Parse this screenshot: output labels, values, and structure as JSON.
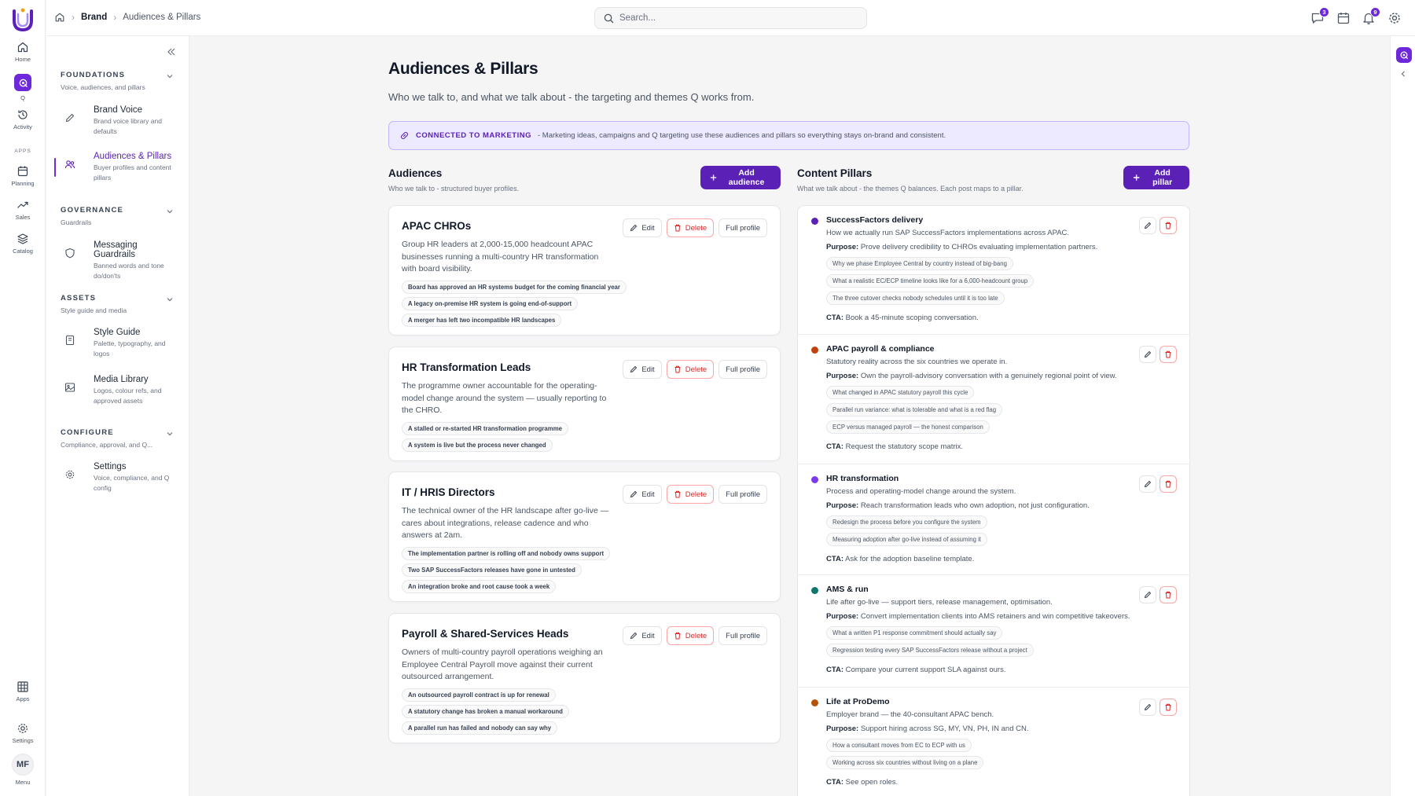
{
  "rail": {
    "items": [
      {
        "label": "Home",
        "icon": "home-icon"
      },
      {
        "label": "Q",
        "icon": "q-icon"
      },
      {
        "label": "Activity",
        "icon": "history-icon"
      },
      {
        "label": "Planning",
        "icon": "calendar-icon"
      },
      {
        "label": "Sales",
        "icon": "trend-icon"
      },
      {
        "label": "Catalog",
        "icon": "layers-icon"
      },
      {
        "label": "Apps",
        "icon": "grid-icon"
      },
      {
        "label": "Settings",
        "icon": "gear-icon"
      },
      {
        "label": "Menu",
        "icon": "avatar"
      }
    ],
    "apps_section": "APPS",
    "avatar_initials": "MF"
  },
  "topbar": {
    "breadcrumb": [
      "Brand",
      "Audiences & Pillars"
    ],
    "search_placeholder": "Search...",
    "messages_badge": "3",
    "notifications_badge": "9"
  },
  "sidebar": {
    "groups": [
      {
        "title": "FOUNDATIONS",
        "sub": "Voice, audiences, and pillars",
        "items": [
          {
            "title": "Brand Voice",
            "desc": "Brand voice library and defaults",
            "icon": "pen-icon"
          },
          {
            "title": "Audiences & Pillars",
            "desc": "Buyer profiles and content pillars",
            "icon": "users-icon"
          }
        ]
      },
      {
        "title": "GOVERNANCE",
        "sub": "Guardrails",
        "items": [
          {
            "title": "Messaging Guardrails",
            "desc": "Banned words and tone do/don'ts",
            "icon": "shield-icon"
          }
        ]
      },
      {
        "title": "ASSETS",
        "sub": "Style guide and media",
        "items": [
          {
            "title": "Style Guide",
            "desc": "Palette, typography, and logos",
            "icon": "book-icon"
          },
          {
            "title": "Media Library",
            "desc": "Logos, colour refs, and approved assets",
            "icon": "image-icon"
          }
        ]
      },
      {
        "title": "CONFIGURE",
        "sub": "Compliance, approval, and Q...",
        "items": [
          {
            "title": "Settings",
            "desc": "Voice, compliance, and Q config",
            "icon": "gear-icon"
          }
        ]
      }
    ]
  },
  "page": {
    "title": "Audiences & Pillars",
    "subtitle": "Who we talk to, and what we talk about - the targeting and themes Q works from.",
    "banner_label": "CONNECTED TO MARKETING",
    "banner_text": "- Marketing ideas, campaigns and Q targeting use these audiences and pillars so everything stays on-brand and consistent."
  },
  "audiences": {
    "title": "Audiences",
    "subtitle": "Who we talk to - structured buyer profiles.",
    "add_label": "Add audience",
    "edit_label": "Edit",
    "delete_label": "Delete",
    "profile_label": "Full profile",
    "items": [
      {
        "name": "APAC CHROs",
        "desc": "Group HR leaders at 2,000-15,000 headcount APAC businesses running a multi-country HR transformation with board visibility.",
        "triggers": [
          "Board has approved an HR systems budget for the coming financial year",
          "A legacy on-premise HR system is going end-of-support",
          "A merger has left two incompatible HR landscapes"
        ]
      },
      {
        "name": "HR Transformation Leads",
        "desc": "The programme owner accountable for the operating-model change around the system — usually reporting to the CHRO.",
        "triggers": [
          "A stalled or re-started HR transformation programme",
          "A system is live but the process never changed"
        ]
      },
      {
        "name": "IT / HRIS Directors",
        "desc": "The technical owner of the HR landscape after go-live — cares about integrations, release cadence and who answers at 2am.",
        "triggers": [
          "The implementation partner is rolling off and nobody owns support",
          "Two SAP SuccessFactors releases have gone in untested",
          "An integration broke and root cause took a week"
        ]
      },
      {
        "name": "Payroll & Shared-Services Heads",
        "desc": "Owners of multi-country payroll operations weighing an Employee Central Payroll move against their current outsourced arrangement.",
        "triggers": [
          "An outsourced payroll contract is up for renewal",
          "A statutory change has broken a manual workaround",
          "A parallel run has failed and nobody can say why"
        ]
      }
    ]
  },
  "pillars": {
    "title": "Content Pillars",
    "subtitle": "What we talk about - the themes Q balances. Each post maps to a pillar.",
    "add_label": "Add pillar",
    "purpose_label": "Purpose:",
    "cta_label": "CTA:",
    "items": [
      {
        "name": "SuccessFactors delivery",
        "color": "#5b21b6",
        "desc": "How we actually run SAP SuccessFactors implementations across APAC.",
        "purpose": "Prove delivery credibility to CHROs evaluating implementation partners.",
        "topics": [
          "Why we phase Employee Central by country instead of big-bang",
          "What a realistic EC/ECP timeline looks like for a 6,000-headcount group",
          "The three cutover checks nobody schedules until it is too late"
        ],
        "cta": "Book a 45-minute scoping conversation."
      },
      {
        "name": "APAC payroll & compliance",
        "color": "#c2410c",
        "desc": "Statutory reality across the six countries we operate in.",
        "purpose": "Own the payroll-advisory conversation with a genuinely regional point of view.",
        "topics": [
          "What changed in APAC statutory payroll this cycle",
          "Parallel run variance: what is tolerable and what is a red flag",
          "ECP versus managed payroll — the honest comparison"
        ],
        "cta": "Request the statutory scope matrix."
      },
      {
        "name": "HR transformation",
        "color": "#7c3aed",
        "desc": "Process and operating-model change around the system.",
        "purpose": "Reach transformation leads who own adoption, not just configuration.",
        "topics": [
          "Redesign the process before you configure the system",
          "Measuring adoption after go-live instead of assuming it"
        ],
        "cta": "Ask for the adoption baseline template."
      },
      {
        "name": "AMS & run",
        "color": "#0f766e",
        "desc": "Life after go-live — support tiers, release management, optimisation.",
        "purpose": "Convert implementation clients into AMS retainers and win competitive takeovers.",
        "topics": [
          "What a written P1 response commitment should actually say",
          "Regression testing every SAP SuccessFactors release without a project"
        ],
        "cta": "Compare your current support SLA against ours."
      },
      {
        "name": "Life at ProDemo",
        "color": "#b45309",
        "desc": "Employer brand — the 40-consultant APAC bench.",
        "purpose": "Support hiring across SG, MY, VN, PH, IN and CN.",
        "topics": [
          "How a consultant moves from EC to ECP with us",
          "Working across six countries without living on a plane"
        ],
        "cta": "See open roles."
      }
    ]
  }
}
